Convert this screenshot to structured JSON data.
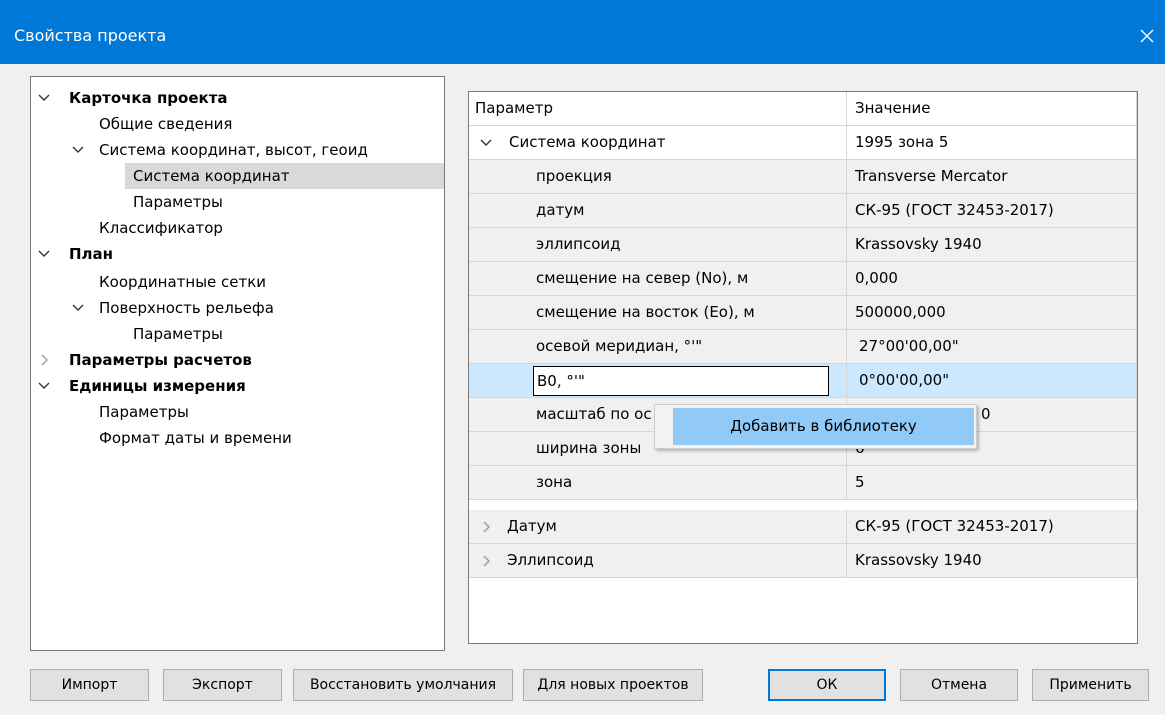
{
  "dialog": {
    "title": "Свойства проекта",
    "accent": "#0078d7"
  },
  "tree": {
    "items": [
      {
        "label": "Карточка проекта",
        "expander": "chevron-down-icon"
      },
      {
        "label": "Общие сведения"
      },
      {
        "label": "Система координат, высот, геоид",
        "expander": "chevron-down-icon"
      },
      {
        "label": "Система координат",
        "selected": true
      },
      {
        "label": "Параметры"
      },
      {
        "label": "Классификатор"
      },
      {
        "label": "План",
        "expander": "chevron-down-icon"
      },
      {
        "label": "Координатные сетки"
      },
      {
        "label": "Поверхность рельефа",
        "expander": "chevron-down-icon"
      },
      {
        "label": "Параметры"
      },
      {
        "label": "Параметры расчетов",
        "expander": "chevron-right-icon"
      },
      {
        "label": "Единицы измерения",
        "expander": "chevron-down-icon"
      },
      {
        "label": "Параметры"
      },
      {
        "label": "Формат даты и времени"
      }
    ]
  },
  "grid": {
    "headers": {
      "param": "Параметр",
      "value": "Значение"
    },
    "rows": [
      {
        "param": "Система координат",
        "value": "1995 зона 5"
      },
      {
        "param": "проекция",
        "value": "Transverse Mercator"
      },
      {
        "param": "датум",
        "value": "СК-95 (ГОСТ 32453-2017)"
      },
      {
        "param": "эллипсоид",
        "value": "Krassovsky 1940"
      },
      {
        "param": "смещение на север (No), м",
        "value": "0,000"
      },
      {
        "param": "смещение на восток (Eo), м",
        "value": "500000,000"
      },
      {
        "param": "осевой меридиан, °'\"",
        "value": "27°00'00,00\""
      },
      {
        "param": "B0, °'\"",
        "value": "0°00'00,00\""
      },
      {
        "param": "масштаб по ос",
        "value": "0"
      },
      {
        "param": "ширина зоны",
        "value": "6°"
      },
      {
        "param": "зона",
        "value": "5"
      },
      {
        "param": "Датум",
        "value": "СК-95 (ГОСТ 32453-2017)"
      },
      {
        "param": "Эллипсоид",
        "value": "Krassovsky 1940"
      }
    ]
  },
  "context_menu": {
    "item": "Добавить в библиотеку"
  },
  "buttons": {
    "import": "Импорт",
    "export": "Экспорт",
    "restore": "Восстановить умолчания",
    "new_projects": "Для новых проектов",
    "ok": "ОК",
    "cancel": "Отмена",
    "apply": "Применить"
  }
}
